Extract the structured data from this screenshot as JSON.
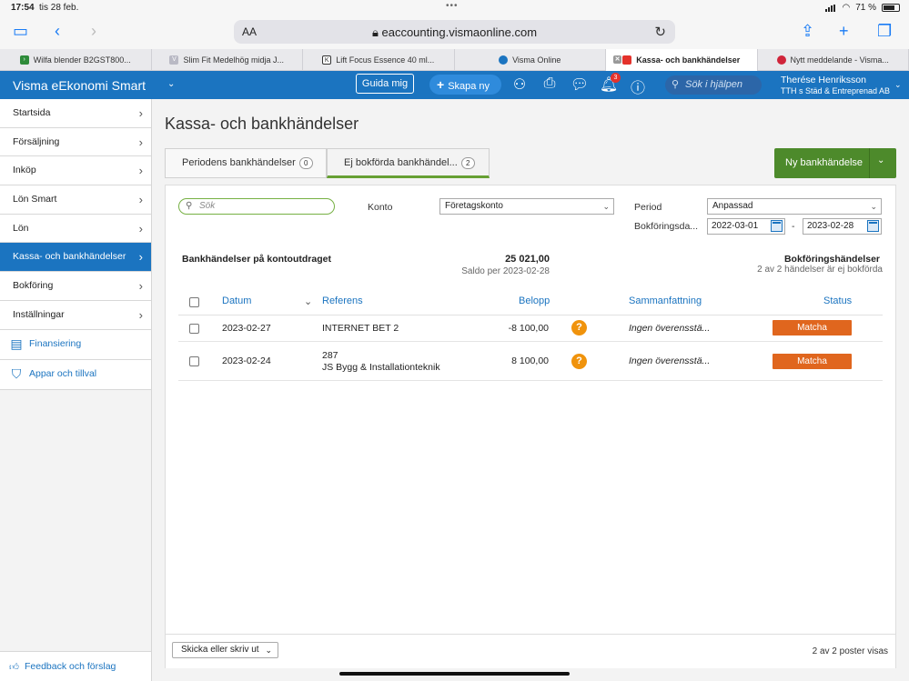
{
  "status_bar": {
    "time": "17:54",
    "date": "tis 28 feb.",
    "battery": "71 %"
  },
  "browser": {
    "address_label": "AA",
    "url": "eaccounting.vismaonline.com",
    "tabs": [
      {
        "label": "Wilfa blender B2GST800...",
        "fav_color": "#2e8b3a"
      },
      {
        "label": "Slim Fit Medelhög midja J...",
        "fav_color": "#b9b9c4"
      },
      {
        "label": "Lift Focus Essence 40 ml...",
        "fav_color": "#333333"
      },
      {
        "label": "Visma Online",
        "fav_color": "#1b74c0"
      },
      {
        "label": "Kassa- och bankhändelser",
        "fav_color": "#e4322b",
        "active": true
      },
      {
        "label": "Nytt meddelande - Visma...",
        "fav_color": "#d0243a"
      }
    ]
  },
  "header": {
    "brand": "Visma eEkonomi Smart",
    "guida": "Guida mig",
    "skapa": "Skapa ny",
    "notifications": "3",
    "search_placeholder": "Sök i hjälpen",
    "user_name": "Therése Henriksson",
    "company": "TTH s Städ & Entreprenad AB"
  },
  "sidebar": {
    "items": [
      {
        "label": "Startsida"
      },
      {
        "label": "Försäljning"
      },
      {
        "label": "Inköp"
      },
      {
        "label": "Lön Smart"
      },
      {
        "label": "Lön"
      },
      {
        "label": "Kassa- och bankhändelser",
        "active": true
      },
      {
        "label": "Bokföring"
      },
      {
        "label": "Inställningar"
      }
    ],
    "links": [
      {
        "label": "Finansiering",
        "icon": "card-icon"
      },
      {
        "label": "Appar och tillval",
        "icon": "basket-icon"
      }
    ],
    "feedback": "Feedback och förslag"
  },
  "page": {
    "title": "Kassa- och bankhändelser",
    "tabs": [
      {
        "label": "Periodens bankhändelser",
        "count": "0"
      },
      {
        "label": "Ej bokförda bankhändel...",
        "count": "2"
      }
    ],
    "new_button": "Ny bankhändelse",
    "filters": {
      "search_placeholder": "Sök",
      "konto_label": "Konto",
      "konto_value": "Företagskonto",
      "period_label": "Period",
      "period_value": "Anpassad",
      "bokdate_label": "Bokföringsda...",
      "date_from": "2022-03-01",
      "date_sep": "-",
      "date_to": "2023-02-28"
    },
    "summary": {
      "title": "Bankhändelser på kontoutdraget",
      "saldo": "25 021,00",
      "saldo_label": "Saldo per 2023-02-28",
      "bok_title": "Bokföringshändelser",
      "bok_sub": "2 av 2 händelser är ej bokförda"
    },
    "table": {
      "headers": {
        "datum": "Datum",
        "referens": "Referens",
        "belopp": "Belopp",
        "sammanfattning": "Sammanfattning",
        "status": "Status"
      },
      "rows": [
        {
          "datum": "2023-02-27",
          "ref1": "INTERNET BET 2",
          "ref2": "",
          "belopp": "-8 100,00",
          "sammanfattning": "Ingen överensstä...",
          "action": "Matcha"
        },
        {
          "datum": "2023-02-24",
          "ref1": "287",
          "ref2": "JS Bygg & Installationteknik",
          "belopp": "8 100,00",
          "sammanfattning": "Ingen överensstä...",
          "action": "Matcha"
        }
      ]
    },
    "footer": {
      "send_button": "Skicka eller skriv ut",
      "count": "2 av 2 poster visas"
    }
  },
  "colors": {
    "brand_blue": "#1b74c0",
    "green": "#4d8a2b",
    "orange": "#e0661e",
    "question": "#f0930c"
  }
}
